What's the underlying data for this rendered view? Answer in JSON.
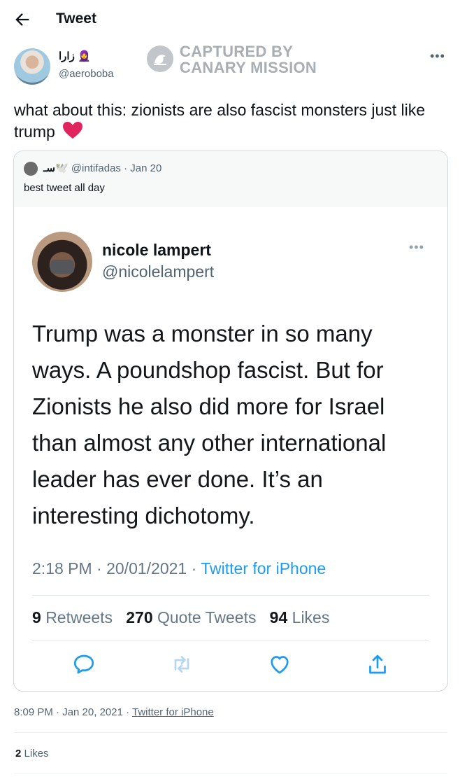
{
  "header": {
    "title": "Tweet",
    "back_icon": "arrow-left-icon"
  },
  "author": {
    "name": "زارا 🧕",
    "handle": "@aeroboba"
  },
  "watermark": {
    "line1": "CAPTURED BY",
    "line2": "CANARY MISSION"
  },
  "tweet": {
    "text": "what about this: zionists are also fascist monsters just like trump",
    "emoji": "❤️"
  },
  "quote": {
    "name": "سـ🕊️",
    "handle": "@intifadas",
    "date": "Jan 20",
    "text": "best tweet all day",
    "embedded": {
      "name": "nicole lampert",
      "handle": "@nicolelampert",
      "text": "Trump was a monster in so many ways. A poundshop fascist. But for Zionists he also did more for Israel than almost any other international leader has ever done. It’s an interesting dichotomy.",
      "time": "2:18 PM · 20/01/2021 · ",
      "source": "Twitter for iPhone",
      "retweets_count": "9",
      "retweets_label": "Retweets",
      "quotes_count": "270",
      "quotes_label": "Quote Tweets",
      "likes_count": "94",
      "likes_label": "Likes"
    }
  },
  "footer": {
    "time": "8:09 PM · Jan 20, 2021 · ",
    "source": "Twitter for iPhone",
    "likes_count": "2",
    "likes_label": "Likes"
  },
  "colors": {
    "accent": "#1d9bf0",
    "muted": "#536471",
    "heart": "#e0245e"
  }
}
